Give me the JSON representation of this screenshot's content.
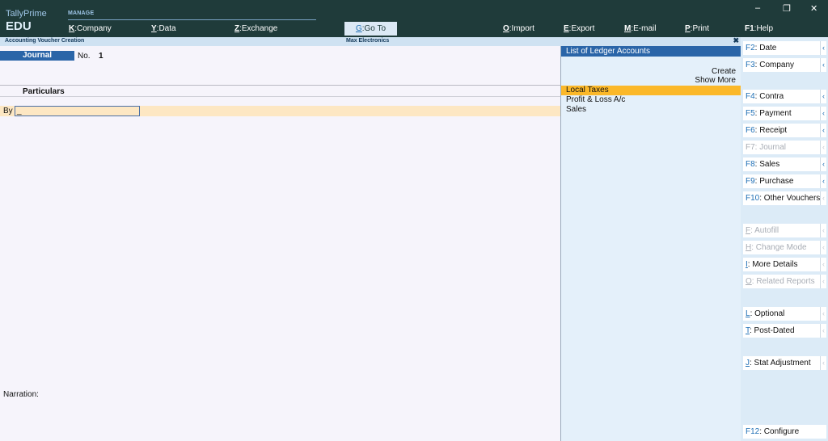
{
  "top_bar": {
    "brand_name": "TallyPrime",
    "brand_edition": "EDU",
    "manage_label": "MANAGE",
    "menu": [
      {
        "key": "K",
        "label": ":Company"
      },
      {
        "key": "Y",
        "label": ":Data"
      },
      {
        "key": "Z",
        "label": ":Exchange"
      },
      {
        "key": "G",
        "label": ":Go To"
      },
      {
        "key": "O",
        "label": ":Import"
      },
      {
        "key": "E",
        "label": ":Export"
      },
      {
        "key": "M",
        "label": ":E-mail"
      },
      {
        "key": "P",
        "label": ":Print"
      },
      {
        "key": "F1",
        "label": ":Help"
      }
    ],
    "window_controls": {
      "minimize": "–",
      "restore": "❐",
      "close": "✕"
    }
  },
  "title_bar": {
    "screen_title": "Accounting Voucher Creation",
    "company_name": "Max Electronics",
    "close_glyph": "✖"
  },
  "voucher": {
    "type": "Journal",
    "no_label": "No.",
    "number": "1",
    "particulars_label": "Particulars",
    "by_label": "By",
    "ledger_input_value": "_",
    "narration_label": "Narration:"
  },
  "ledger_panel": {
    "title": "List of Ledger Accounts",
    "create_label": "Create",
    "show_more_label": "Show More",
    "items": [
      "Local Taxes",
      "Profit & Loss A/c",
      "Sales"
    ],
    "selected_index": 0
  },
  "right_buttons": [
    {
      "key": "F2",
      "label": ": Date",
      "disabled": false,
      "arrow": true
    },
    {
      "key": "F3",
      "label": ": Company",
      "disabled": false,
      "arrow": true
    },
    {
      "key": "F4",
      "label": ": Contra",
      "disabled": false,
      "arrow": true
    },
    {
      "key": "F5",
      "label": ": Payment",
      "disabled": false,
      "arrow": true
    },
    {
      "key": "F6",
      "label": ": Receipt",
      "disabled": false,
      "arrow": true
    },
    {
      "key": "F7",
      "label": ": Journal",
      "disabled": true,
      "arrow": true
    },
    {
      "key": "F8",
      "label": ": Sales",
      "disabled": false,
      "arrow": true
    },
    {
      "key": "F9",
      "label": ": Purchase",
      "disabled": false,
      "arrow": true
    },
    {
      "key": "F10",
      "label": ": Other Vouchers",
      "disabled": false,
      "arrow": true
    },
    {
      "key": "F",
      "label": ": Autofill",
      "disabled": true,
      "arrow": true
    },
    {
      "key": "H",
      "label": ": Change Mode",
      "disabled": true,
      "arrow": true
    },
    {
      "key": "I",
      "label": ": More Details",
      "disabled": false,
      "arrow": true
    },
    {
      "key": "O",
      "label": ": Related Reports",
      "disabled": true,
      "arrow": true
    },
    {
      "key": "L",
      "label": ": Optional",
      "disabled": false,
      "arrow": true
    },
    {
      "key": "T",
      "label": ": Post-Dated",
      "disabled": false,
      "arrow": true
    },
    {
      "key": "J",
      "label": ": Stat Adjustment",
      "disabled": false,
      "arrow": true
    },
    {
      "key": "F12",
      "label": ": Configure",
      "disabled": false,
      "arrow": false
    }
  ],
  "colors": {
    "top_bar_bg": "#1f3b3a",
    "accent_blue": "#2a65a8",
    "selection_orange": "#fbb829",
    "input_row_bg": "#fde7c3"
  }
}
